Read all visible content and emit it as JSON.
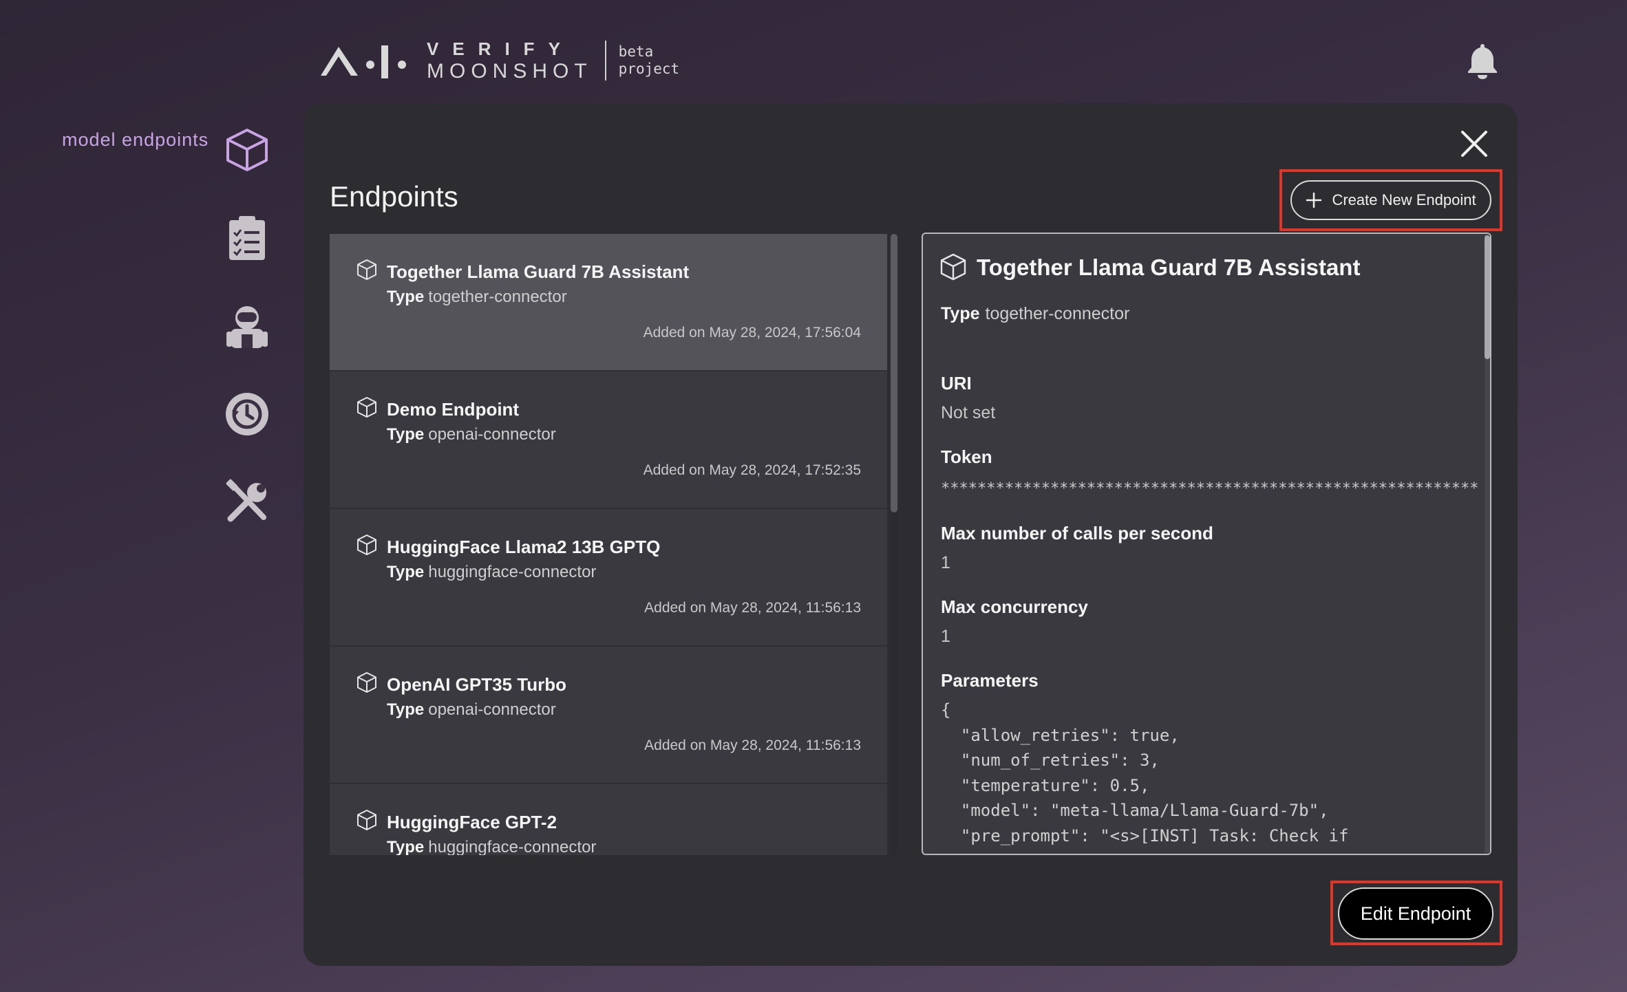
{
  "header": {
    "logo_line1": "VERIFY",
    "logo_line2": "MOONSHOT",
    "tag_line1": "beta",
    "tag_line2": "project",
    "notification_icon": "bell-icon"
  },
  "sidebar": {
    "active_label": "model endpoints",
    "items": [
      {
        "icon": "cube-icon",
        "active": true
      },
      {
        "icon": "clipboard-icon",
        "active": false
      },
      {
        "icon": "astronaut-icon",
        "active": false
      },
      {
        "icon": "history-icon",
        "active": false
      },
      {
        "icon": "tools-icon",
        "active": false
      }
    ]
  },
  "panel": {
    "title": "Endpoints",
    "create_label": "Create New Endpoint",
    "edit_label": "Edit Endpoint"
  },
  "endpoints": [
    {
      "name": "Together Llama Guard 7B Assistant",
      "type_label": "Type",
      "type": "together-connector",
      "added": "Added on May 28, 2024, 17:56:04"
    },
    {
      "name": "Demo Endpoint",
      "type_label": "Type",
      "type": "openai-connector",
      "added": "Added on May 28, 2024, 17:52:35"
    },
    {
      "name": "HuggingFace Llama2 13B GPTQ",
      "type_label": "Type",
      "type": "huggingface-connector",
      "added": "Added on May 28, 2024, 11:56:13"
    },
    {
      "name": "OpenAI GPT35 Turbo",
      "type_label": "Type",
      "type": "openai-connector",
      "added": "Added on May 28, 2024, 11:56:13"
    },
    {
      "name": "HuggingFace GPT-2",
      "type_label": "Type",
      "type": "huggingface-connector",
      "added": ""
    }
  ],
  "detail": {
    "title": "Together Llama Guard 7B Assistant",
    "type_label": "Type",
    "type": "together-connector",
    "uri_label": "URI",
    "uri": "Not set",
    "token_label": "Token",
    "token": "*******************************************************************",
    "max_calls_label": "Max number of calls per second",
    "max_calls": "1",
    "max_concurrency_label": "Max concurrency",
    "max_concurrency": "1",
    "parameters_label": "Parameters",
    "parameters": "{\n  \"allow_retries\": true,\n  \"num_of_retries\": 3,\n  \"temperature\": 0.5,\n  \"model\": \"meta-llama/Llama-Guard-7b\",\n  \"pre_prompt\": \"<s>[INST] Task: Check if"
  },
  "colors": {
    "accent_label": "#c9a4e4",
    "highlight_border": "#e0362a",
    "panel_bg": "#2d2c31",
    "selected_item": "#55535a"
  }
}
